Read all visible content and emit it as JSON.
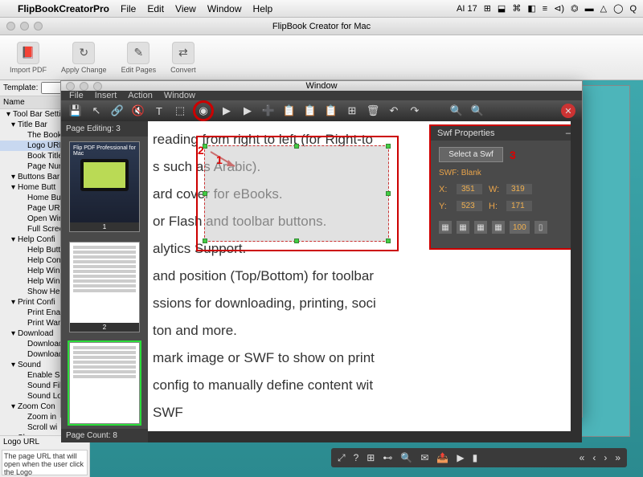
{
  "menubar": {
    "apple": "",
    "app": "FlipBookCreatorPro",
    "items": [
      "File",
      "Edit",
      "View",
      "Window",
      "Help"
    ],
    "tray": [
      "AI 17",
      "⊞",
      "⬓",
      "⌘",
      "◧",
      "≡",
      "⊲)",
      "⏣",
      "▬",
      "△",
      "◯",
      "Q"
    ]
  },
  "apptitle": "FlipBook Creator for Mac",
  "ribbon": [
    {
      "icon": "📕",
      "label": "Import PDF"
    },
    {
      "icon": "↻",
      "label": "Apply Change"
    },
    {
      "icon": "✎",
      "label": "Edit Pages"
    },
    {
      "icon": "⇄",
      "label": "Convert"
    }
  ],
  "template": {
    "label": "Template:",
    "selected": "",
    "name_header": "Name",
    "tree": [
      {
        "t": "Tool Bar Setti",
        "l": 0,
        "a": "▾"
      },
      {
        "t": "Title Bar",
        "l": 1,
        "a": "▾"
      },
      {
        "t": "The Book",
        "l": 2
      },
      {
        "t": "Logo URL",
        "l": 2,
        "sel": true
      },
      {
        "t": "Book Title",
        "l": 2
      },
      {
        "t": "Page Num",
        "l": 2
      },
      {
        "t": "Buttons Bar",
        "l": 1,
        "a": "▾"
      },
      {
        "t": "Home Butt",
        "l": 1,
        "a": "▾"
      },
      {
        "t": "Home Bu",
        "l": 2
      },
      {
        "t": "Page URL",
        "l": 2
      },
      {
        "t": "Open Wir",
        "l": 2
      },
      {
        "t": "Full Screen",
        "l": 2
      },
      {
        "t": "Help Confi",
        "l": 1,
        "a": "▾"
      },
      {
        "t": "Help Butt",
        "l": 2
      },
      {
        "t": "Help Con",
        "l": 2
      },
      {
        "t": "Help Win",
        "l": 2
      },
      {
        "t": "Help Win",
        "l": 2
      },
      {
        "t": "Show Hel",
        "l": 2
      },
      {
        "t": "Print Confi",
        "l": 1,
        "a": "▾"
      },
      {
        "t": "Print Enal",
        "l": 2
      },
      {
        "t": "Print War",
        "l": 2
      },
      {
        "t": "Download",
        "l": 1,
        "a": "▾"
      },
      {
        "t": "Download",
        "l": 2
      },
      {
        "t": "Download",
        "l": 2
      },
      {
        "t": "Sound",
        "l": 1,
        "a": "▾"
      },
      {
        "t": "Enable Sc",
        "l": 2
      },
      {
        "t": "Sound Fil",
        "l": 2
      },
      {
        "t": "Sound Lo",
        "l": 2
      },
      {
        "t": "Zoom Con",
        "l": 1,
        "a": "▾"
      },
      {
        "t": "Zoom in",
        "l": 2
      },
      {
        "t": "Scroll wi",
        "l": 2
      },
      {
        "t": "Share",
        "l": 1,
        "a": "▾"
      }
    ],
    "hint_label": "Logo URL",
    "hint_text": "The page URL that will open when the user click the Logo"
  },
  "editor": {
    "title": "Window",
    "menus": [
      "File",
      "Insert",
      "Action",
      "Window"
    ],
    "toolbar_icons": [
      "💾",
      "↖",
      "🔗",
      "🔇",
      "T",
      "⬚",
      "◉",
      "▶",
      "▶",
      "➕",
      "📋",
      "📋",
      "📋",
      "⊞",
      "🗑",
      "↶",
      "↷",
      "",
      "🔍",
      "🔍"
    ],
    "circled_index": 6,
    "page_editing": "Page Editing: 3",
    "thumb1_title": "Flip PDF Professional for Mac",
    "thumb_caps": [
      "1",
      "2"
    ],
    "page_count": "Page Count: 8",
    "bg_lines": [
      "reading from right to left (for Right-to",
      "s such as Arabic).",
      "ard cover for eBooks.",
      "or Flash and toolbar buttons.",
      "alytics Support.",
      "and position (Top/Bottom) for toolbar",
      "ssions for downloading, printing, soci",
      "ton and more.",
      "mark image or SWF to show on print",
      "config to manually define content wit",
      "SWF"
    ],
    "annotations": {
      "1": "1",
      "2": "2",
      "3": "3"
    },
    "props": {
      "title": "Swf Properties",
      "button": "Select a Swf",
      "status": "SWF: Blank",
      "X": "351",
      "W": "319",
      "Y": "523",
      "H": "171",
      "depth": "100"
    }
  },
  "ctrlbar_left": [
    "⤢",
    "?",
    "⊞",
    "⊷",
    "🔍",
    "✉",
    "📤",
    "▶",
    "▮"
  ],
  "ctrlbar_right": [
    "«",
    "‹",
    "›",
    "»"
  ]
}
